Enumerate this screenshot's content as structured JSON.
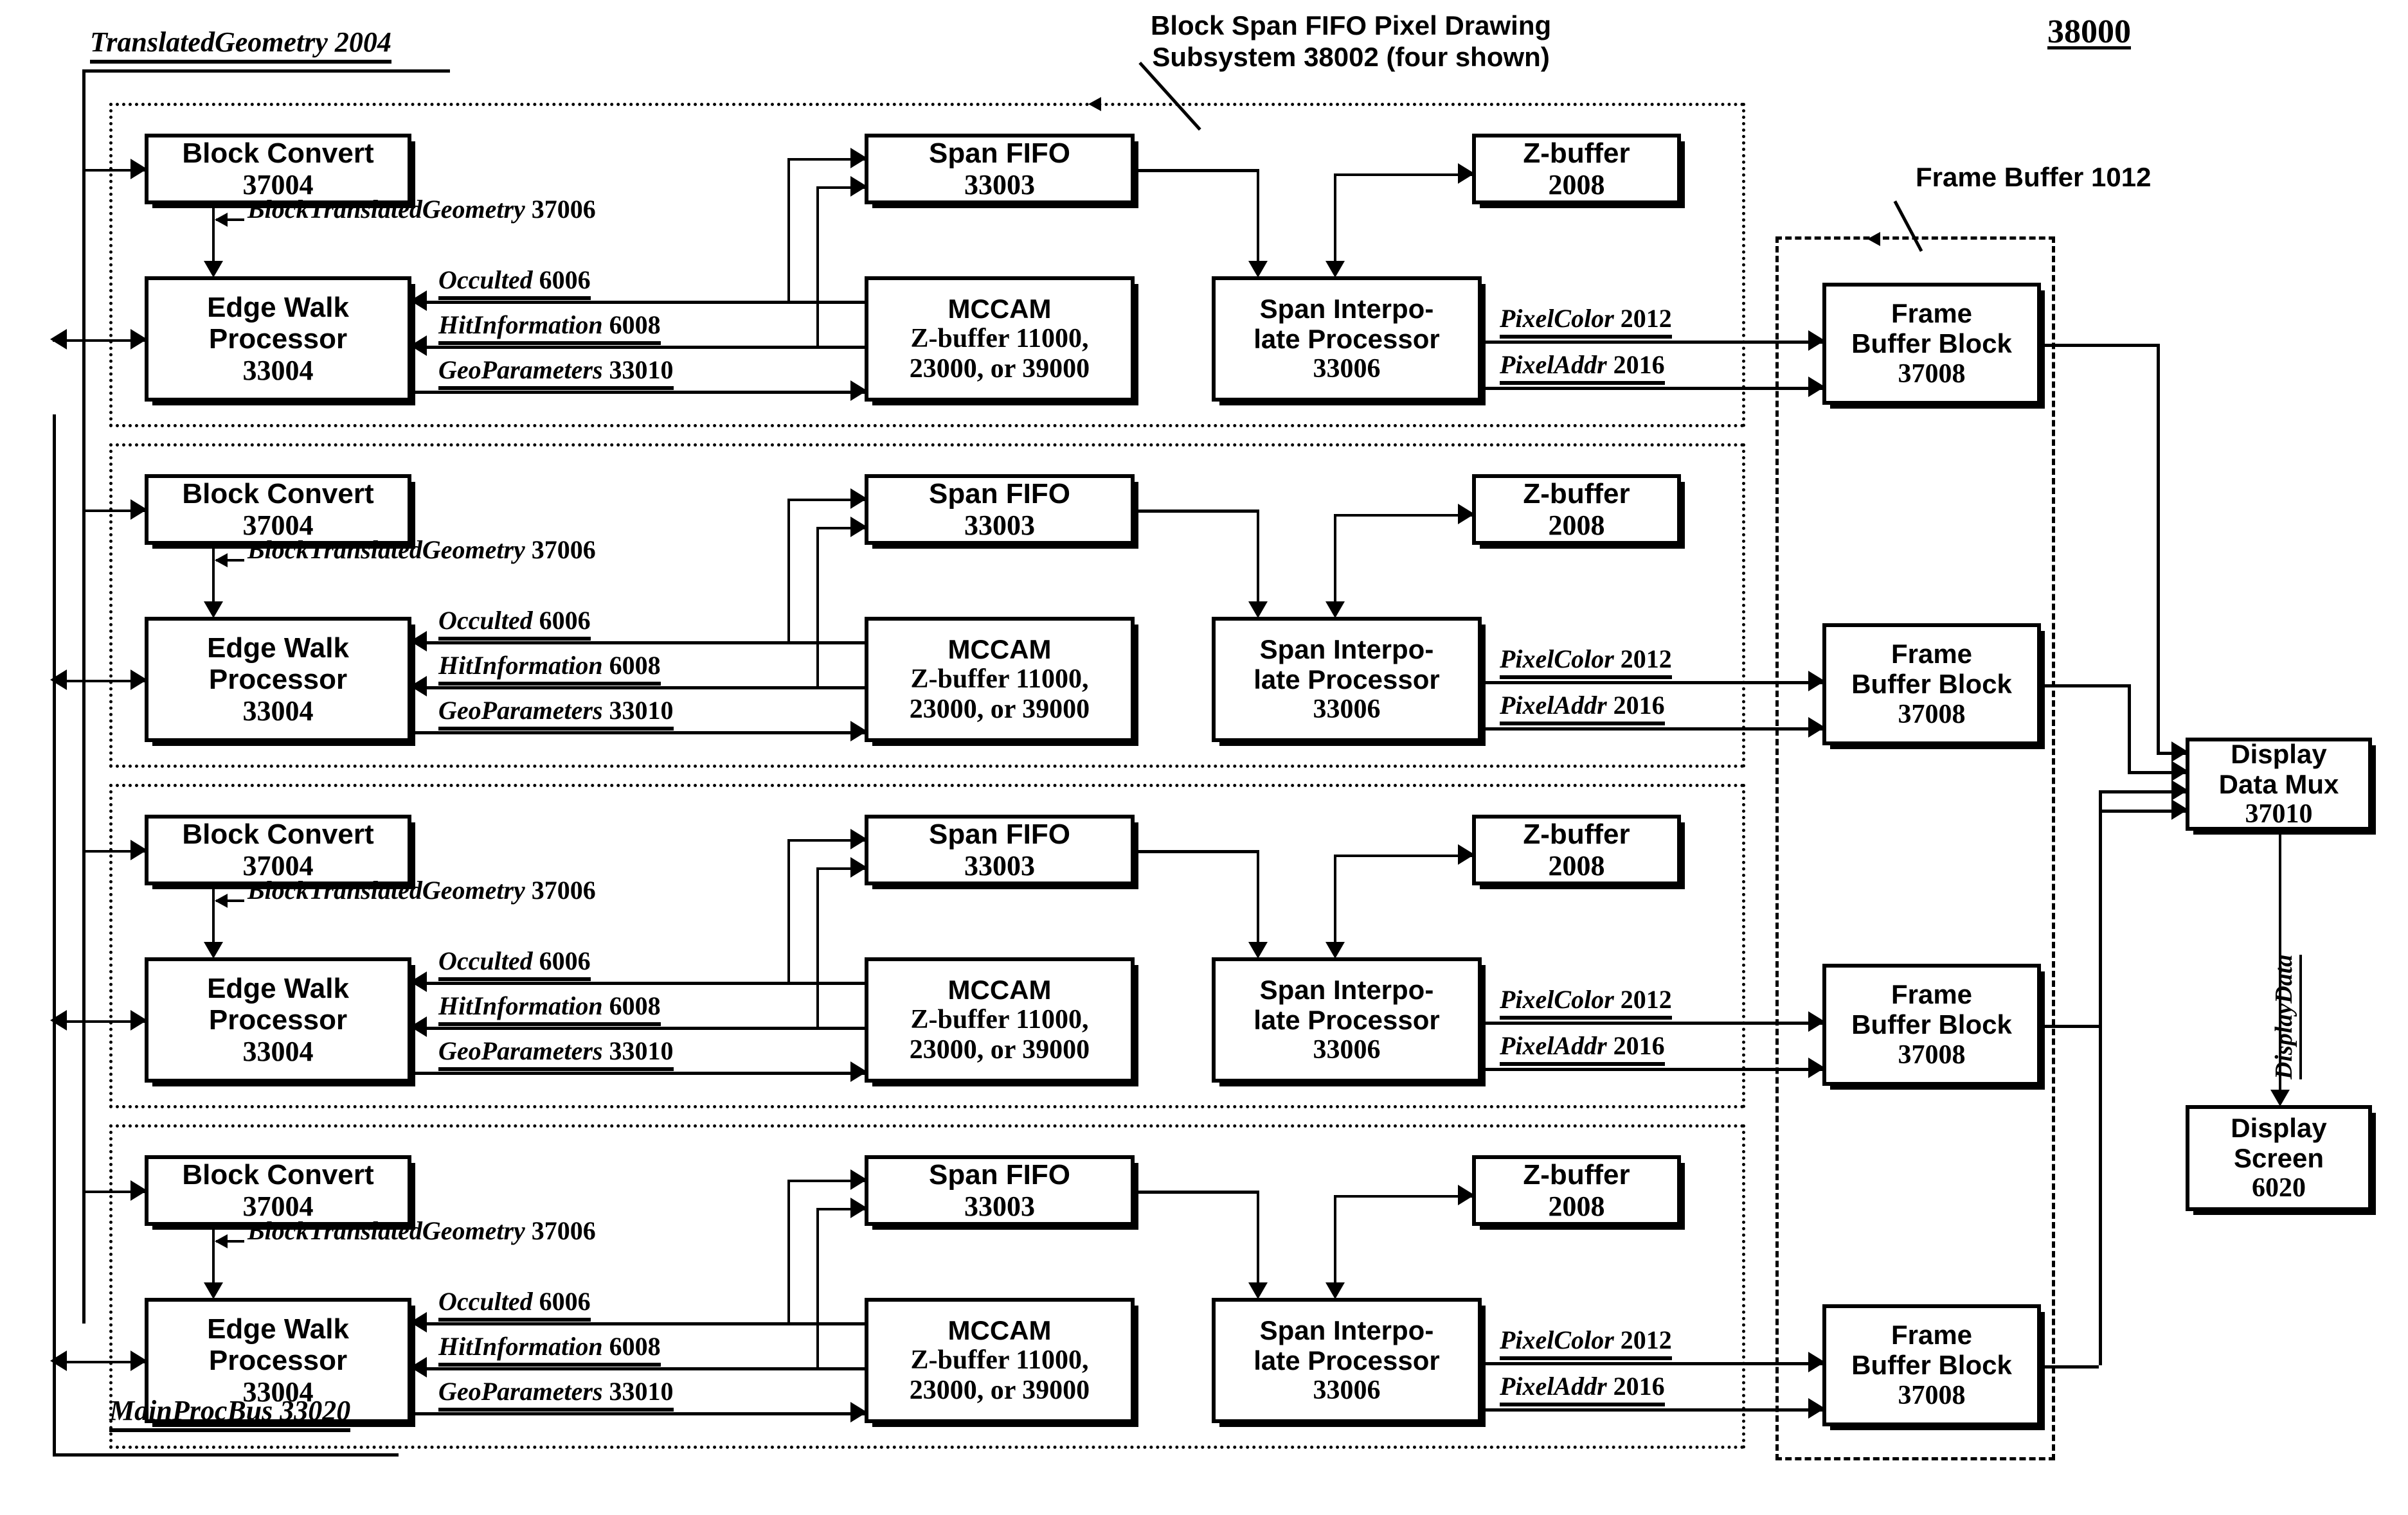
{
  "figure": {
    "number": "38000",
    "subsystem_caption_line1": "Block Span FIFO Pixel Drawing",
    "subsystem_caption_line2": "Subsystem 38002 (four shown)",
    "frame_buffer_caption": "Frame Buffer 1012",
    "top_bus_label": "TranslatedGeometry 2004",
    "bottom_bus_label": "MainProcBus 33020"
  },
  "blocks": {
    "block_convert": {
      "line1": "Block Convert",
      "num": "37004"
    },
    "edge_walk": {
      "line1": "Edge Walk",
      "line2": "Processor",
      "num": "33004"
    },
    "span_fifo": {
      "line1": "Span FIFO",
      "num": "33003"
    },
    "mccam": {
      "line1": "MCCAM",
      "line2": "Z-buffer 11000,",
      "line3": "23000, or 39000"
    },
    "zbuffer": {
      "line1": "Z-buffer",
      "num": "2008"
    },
    "span_interp": {
      "line1": "Span Interpo-",
      "line2": "late Processor",
      "num": "33006"
    },
    "frame_buffer_block": {
      "line1": "Frame",
      "line2": "Buffer Block",
      "num": "37008"
    },
    "display_mux": {
      "line1": "Display",
      "line2": "Data Mux",
      "num": "37010"
    },
    "display_screen": {
      "line1": "Display",
      "line2": "Screen",
      "num": "6020"
    }
  },
  "signals": {
    "block_translated_geometry": {
      "name": "BlockTranslatedGeometry",
      "num": "37006"
    },
    "occulted": {
      "name": "Occulted",
      "num": "6006"
    },
    "hit_information": {
      "name": "HitInformation",
      "num": "6008"
    },
    "geo_parameters": {
      "name": "GeoParameters",
      "num": "33010"
    },
    "pixel_color": {
      "name": "PixelColor",
      "num": "2012"
    },
    "pixel_addr": {
      "name": "PixelAddr",
      "num": "2016"
    },
    "display_data": {
      "name": "DisplayData"
    }
  },
  "rows": [
    {
      "index": 1
    },
    {
      "index": 2
    },
    {
      "index": 3
    },
    {
      "index": 4
    }
  ],
  "colors": {
    "ink": "#000000",
    "paper": "#ffffff"
  }
}
